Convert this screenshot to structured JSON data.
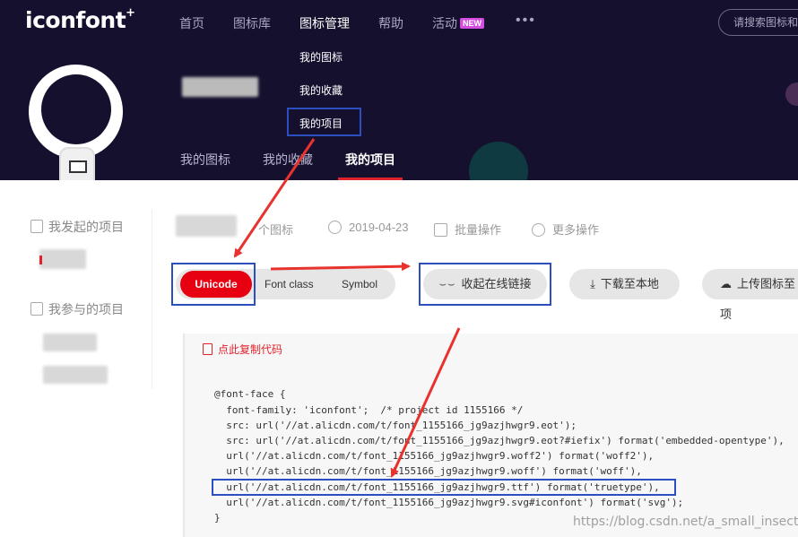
{
  "header": {
    "logo": "iconfont",
    "logo_plus": "+",
    "nav": [
      {
        "label": "首页"
      },
      {
        "label": "图标库"
      },
      {
        "label": "图标管理"
      },
      {
        "label": "帮助"
      },
      {
        "label": "活动"
      }
    ],
    "new_badge": "NEW",
    "more": "•••",
    "search_placeholder": "请搜索图标和",
    "dropdown": [
      "我的图标",
      "我的收藏",
      "我的项目"
    ]
  },
  "profile": {
    "tabs": [
      {
        "label": "我的图标"
      },
      {
        "label": "我的收藏"
      },
      {
        "label": "我的项目"
      }
    ]
  },
  "sidebar": {
    "created_title": "我发起的项目",
    "joined_title": "我参与的项目"
  },
  "project": {
    "icon_count_suffix": "个图标",
    "date": "2019-04-23",
    "batch": "批量操作",
    "more": "更多操作"
  },
  "toolbar": {
    "modes": [
      "Unicode",
      "Font class",
      "Symbol"
    ],
    "collapse_link": "收起在线链接",
    "download": "下载至本地",
    "upload": "上传图标至项"
  },
  "code": {
    "copy_label": "点此复制代码",
    "lines": [
      "@font-face {",
      "  font-family: 'iconfont';  /* project id 1155166 */",
      "  src: url('//at.alicdn.com/t/font_1155166_jg9azjhwgr9.eot');",
      "  src: url('//at.alicdn.com/t/font_1155166_jg9azjhwgr9.eot?#iefix') format('embedded-opentype'),",
      "  url('//at.alicdn.com/t/font_1155166_jg9azjhwgr9.woff2') format('woff2'),",
      "  url('//at.alicdn.com/t/font_1155166_jg9azjhwgr9.woff') format('woff'),",
      "  url('//at.alicdn.com/t/font_1155166_jg9azjhwgr9.ttf') format('truetype'),",
      "  url('//at.alicdn.com/t/font_1155166_jg9azjhwgr9.svg#iconfont') format('svg');",
      "}"
    ]
  },
  "watermark": "https://blog.csdn.net/a_small_insect",
  "colors": {
    "header_bg": "#16102f",
    "accent_red": "#e60012",
    "annotation_blue": "#2c4fbf",
    "annotation_arrow": "#e8322e"
  }
}
